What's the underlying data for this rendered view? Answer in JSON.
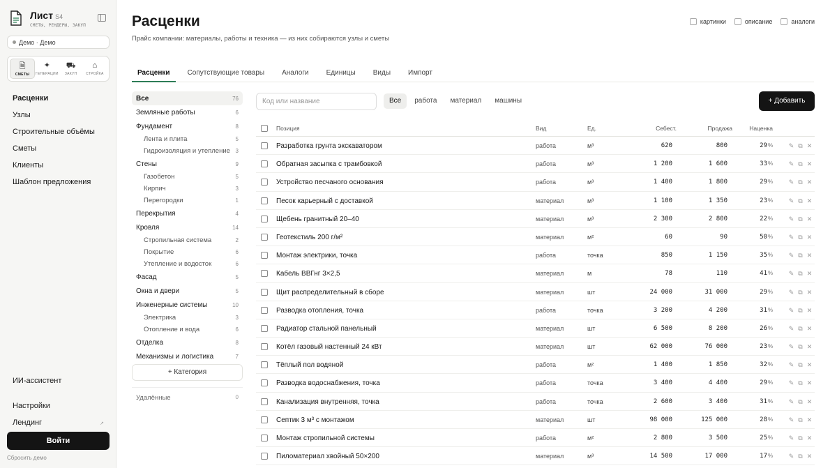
{
  "app": {
    "name": "Лист",
    "version": "S4",
    "subtitle": "СМЕТЫ, РЕНДЕРЫ, ЗАКУП",
    "demo_label": "Демо · Демо"
  },
  "modes": [
    {
      "label": "СМЕТЫ",
      "icon": "doc-icon"
    },
    {
      "label": "ГЕНЕРАЦИИ",
      "icon": "sparkle-icon"
    },
    {
      "label": "ЗАКУП",
      "icon": "cart-icon"
    },
    {
      "label": "СТРОЙКА",
      "icon": "building-icon"
    }
  ],
  "nav": [
    "Расценки",
    "Узлы",
    "Строительные объёмы",
    "Сметы",
    "Клиенты",
    "Шаблон предложения"
  ],
  "sidebar_bottom": {
    "ai": "ИИ-ассистент",
    "settings": "Настройки",
    "landing": "Лендинг",
    "login": "Войти",
    "reset": "Сбросить демо"
  },
  "page": {
    "title": "Расценки",
    "subtitle": "Прайс компании: материалы, работы и техника — из них собираются узлы и сметы"
  },
  "toggles": [
    "картинки",
    "описание",
    "аналоги"
  ],
  "tabs": [
    "Расценки",
    "Сопутствующие товары",
    "Аналоги",
    "Единицы",
    "Виды",
    "Импорт"
  ],
  "categories": [
    {
      "label": "Все",
      "count": "76",
      "level": 0,
      "active": true
    },
    {
      "label": "Земляные работы",
      "count": "6",
      "level": 0
    },
    {
      "label": "Фундамент",
      "count": "8",
      "level": 0
    },
    {
      "label": "Лента и плита",
      "count": "5",
      "level": 1
    },
    {
      "label": "Гидроизоляция и утепление",
      "count": "3",
      "level": 1
    },
    {
      "label": "Стены",
      "count": "9",
      "level": 0
    },
    {
      "label": "Газобетон",
      "count": "5",
      "level": 1
    },
    {
      "label": "Кирпич",
      "count": "3",
      "level": 1
    },
    {
      "label": "Перегородки",
      "count": "1",
      "level": 1
    },
    {
      "label": "Перекрытия",
      "count": "4",
      "level": 0
    },
    {
      "label": "Кровля",
      "count": "14",
      "level": 0
    },
    {
      "label": "Стропильная система",
      "count": "2",
      "level": 1
    },
    {
      "label": "Покрытие",
      "count": "6",
      "level": 1
    },
    {
      "label": "Утепление и водосток",
      "count": "6",
      "level": 1
    },
    {
      "label": "Фасад",
      "count": "5",
      "level": 0
    },
    {
      "label": "Окна и двери",
      "count": "5",
      "level": 0
    },
    {
      "label": "Инженерные системы",
      "count": "10",
      "level": 0
    },
    {
      "label": "Электрика",
      "count": "3",
      "level": 1
    },
    {
      "label": "Отопление и вода",
      "count": "6",
      "level": 1
    },
    {
      "label": "Отделка",
      "count": "8",
      "level": 0
    },
    {
      "label": "Механизмы и логистика",
      "count": "7",
      "level": 0
    }
  ],
  "add_category": "+ Категория",
  "deleted": {
    "label": "Удалённые",
    "count": "0"
  },
  "search": {
    "placeholder": "Код или название"
  },
  "filters": [
    "Все",
    "работа",
    "материал",
    "машины"
  ],
  "add_button": "+ Добавить",
  "table": {
    "columns": {
      "name": "Позиция",
      "kind": "Вид",
      "unit": "Ед.",
      "cost": "Себест.",
      "sale": "Продажа",
      "markup": "Наценка"
    },
    "rows": [
      {
        "name": "Разработка грунта экскаватором",
        "kind": "работа",
        "unit": "м³",
        "cost": "620",
        "sale": "800",
        "markup": "29"
      },
      {
        "name": "Обратная засыпка с трамбовкой",
        "kind": "работа",
        "unit": "м³",
        "cost": "1 200",
        "sale": "1 600",
        "markup": "33"
      },
      {
        "name": "Устройство песчаного основания",
        "kind": "работа",
        "unit": "м³",
        "cost": "1 400",
        "sale": "1 800",
        "markup": "29"
      },
      {
        "name": "Песок карьерный с доставкой",
        "kind": "материал",
        "unit": "м³",
        "cost": "1 100",
        "sale": "1 350",
        "markup": "23"
      },
      {
        "name": "Щебень гранитный 20–40",
        "kind": "материал",
        "unit": "м³",
        "cost": "2 300",
        "sale": "2 800",
        "markup": "22"
      },
      {
        "name": "Геотекстиль 200 г/м²",
        "kind": "материал",
        "unit": "м²",
        "cost": "60",
        "sale": "90",
        "markup": "50"
      },
      {
        "name": "Монтаж электрики, точка",
        "kind": "работа",
        "unit": "точка",
        "cost": "850",
        "sale": "1 150",
        "markup": "35"
      },
      {
        "name": "Кабель ВВГнг 3×2,5",
        "kind": "материал",
        "unit": "м",
        "cost": "78",
        "sale": "110",
        "markup": "41"
      },
      {
        "name": "Щит распределительный в сборе",
        "kind": "материал",
        "unit": "шт",
        "cost": "24 000",
        "sale": "31 000",
        "markup": "29"
      },
      {
        "name": "Разводка отопления, точка",
        "kind": "работа",
        "unit": "точка",
        "cost": "3 200",
        "sale": "4 200",
        "markup": "31"
      },
      {
        "name": "Радиатор стальной панельный",
        "kind": "материал",
        "unit": "шт",
        "cost": "6 500",
        "sale": "8 200",
        "markup": "26"
      },
      {
        "name": "Котёл газовый настенный 24 кВт",
        "kind": "материал",
        "unit": "шт",
        "cost": "62 000",
        "sale": "76 000",
        "markup": "23"
      },
      {
        "name": "Тёплый пол водяной",
        "kind": "работа",
        "unit": "м²",
        "cost": "1 400",
        "sale": "1 850",
        "markup": "32"
      },
      {
        "name": "Разводка водоснабжения, точка",
        "kind": "работа",
        "unit": "точка",
        "cost": "3 400",
        "sale": "4 400",
        "markup": "29"
      },
      {
        "name": "Канализация внутренняя, точка",
        "kind": "работа",
        "unit": "точка",
        "cost": "2 600",
        "sale": "3 400",
        "markup": "31"
      },
      {
        "name": "Септик 3 м³ с монтажом",
        "kind": "материал",
        "unit": "шт",
        "cost": "98 000",
        "sale": "125 000",
        "markup": "28"
      },
      {
        "name": "Монтаж стропильной системы",
        "kind": "работа",
        "unit": "м²",
        "cost": "2 800",
        "sale": "3 500",
        "markup": "25"
      },
      {
        "name": "Пиломатериал хвойный 50×200",
        "kind": "материал",
        "unit": "м³",
        "cost": "14 500",
        "sale": "17 000",
        "markup": "17"
      }
    ],
    "percent_sign": "%",
    "actions": {
      "edit": "✎",
      "copy": "⧉",
      "delete": "✕"
    }
  }
}
